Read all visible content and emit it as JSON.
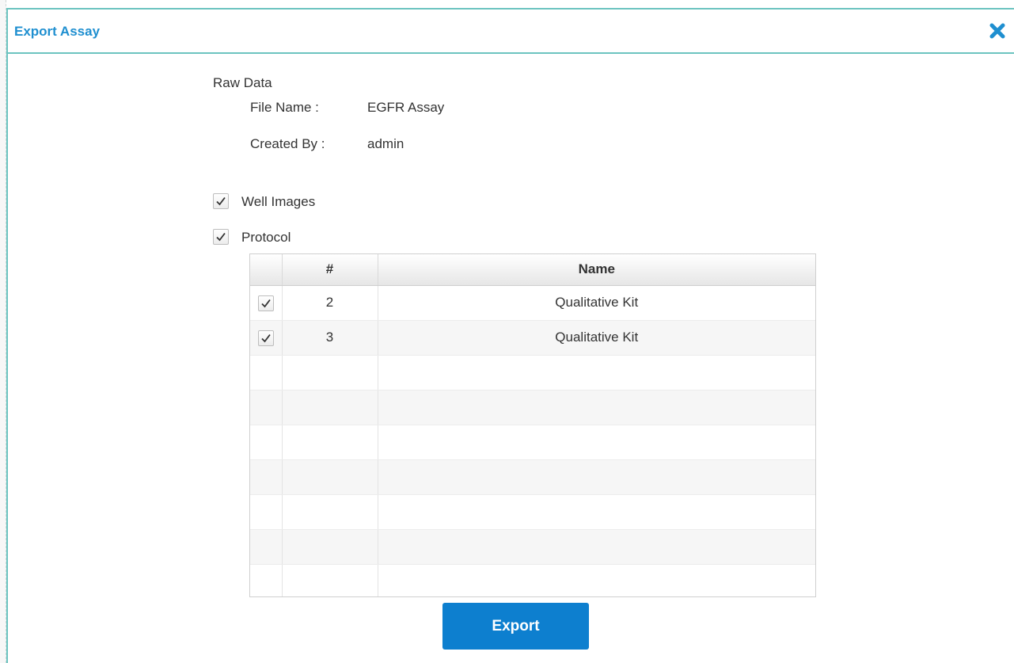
{
  "dialog": {
    "title": "Export Assay",
    "close_icon": "close-x-icon",
    "accent_color": "#1f8fd0",
    "border_color": "#6cc4c0"
  },
  "raw_data": {
    "heading": "Raw Data",
    "file_name_label": "File Name :",
    "file_name_value": "EGFR Assay",
    "created_by_label": "Created By :",
    "created_by_value": "admin"
  },
  "options": {
    "well_images": {
      "label": "Well Images",
      "checked": true
    },
    "protocol": {
      "label": "Protocol",
      "checked": true
    }
  },
  "protocol_table": {
    "columns": [
      "",
      "#",
      "Name"
    ],
    "rows": [
      {
        "checked": true,
        "number": "2",
        "name": "Qualitative Kit"
      },
      {
        "checked": true,
        "number": "3",
        "name": "Qualitative Kit"
      }
    ]
  },
  "export_button": {
    "label": "Export",
    "color": "#0d7fcf"
  }
}
